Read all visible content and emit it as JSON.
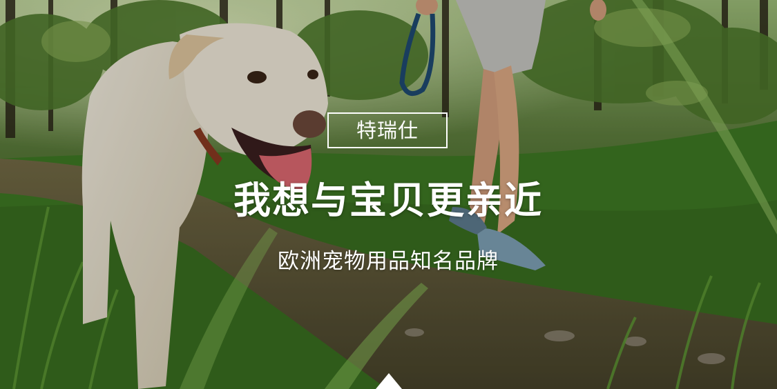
{
  "banner": {
    "brand_name": "特瑞仕",
    "headline": "我想与宝贝更亲近",
    "subheadline": "欧洲宠物用品知名品牌",
    "background_image": "dog-walking-in-forest-photo",
    "scroll_indicator_icon": "triangle-up-icon"
  }
}
